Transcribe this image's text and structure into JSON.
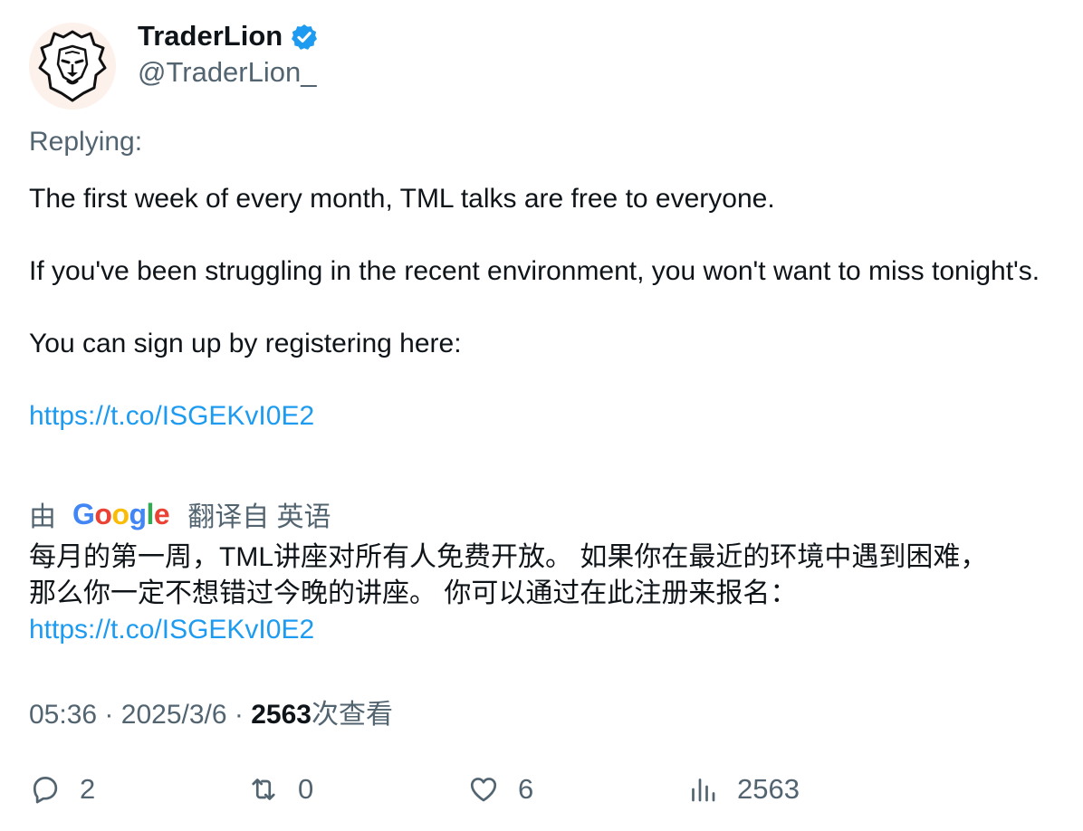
{
  "author": {
    "display_name": "TraderLion",
    "handle": "@TraderLion_",
    "verified": true,
    "avatar_icon": "lion-head-icon"
  },
  "tweet": {
    "replying_label": "Replying:",
    "paragraphs": [
      "The first week of every month, TML talks are free to everyone.",
      "If you've been struggling in the recent environment, you won't want to miss tonight's.",
      "You can sign up by registering here:"
    ],
    "link": "https://t.co/ISGEKvI0E2"
  },
  "translation": {
    "by": "由",
    "provider": "Google",
    "translated_from": "翻译自 英语",
    "text_line1": "每月的第一周，TML讲座对所有人免费开放。 如果你在最近的环境中遇到困难，",
    "text_line2": "那么你一定不想错过今晚的讲座。 你可以通过在此注册来报名：",
    "link": "https://t.co/ISGEKvI0E2"
  },
  "meta": {
    "time": "05:36",
    "separator": "·",
    "date": "2025/3/6",
    "views_count": "2563",
    "views_label": "次查看"
  },
  "actions": {
    "replies": "2",
    "retweets": "0",
    "likes": "6",
    "views": "2563"
  },
  "colors": {
    "link": "#1d9bf0",
    "secondary_text": "#536471",
    "primary_text": "#0f1419",
    "verified_badge": "#1d9bf0"
  }
}
